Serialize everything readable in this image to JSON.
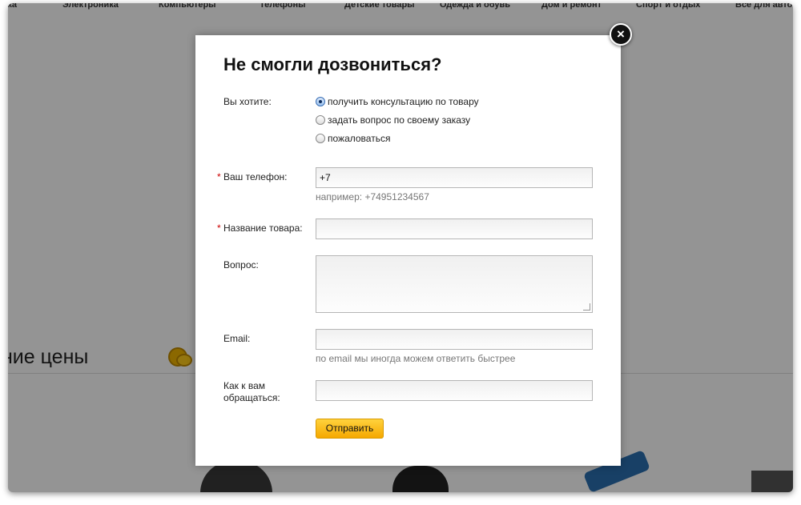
{
  "background": {
    "nav_items": [
      "ника",
      "Электроника",
      "Компьютеры",
      "Телефоны",
      "Детские товары",
      "Одежда и обувь",
      "Дом и ремонт",
      "Спорт и отдых",
      "Все для авто"
    ],
    "section_title": "ние цены"
  },
  "modal": {
    "title": "Не смогли дозвониться?",
    "close_label": "×",
    "intent": {
      "label": "Вы хотите:",
      "options": [
        "получить консультацию по товару",
        "задать вопрос по своему заказу",
        "пожаловаться"
      ],
      "selected_index": 0
    },
    "phone": {
      "label": "Ваш телефон:",
      "value": "+7",
      "hint": "например: +74951234567"
    },
    "product": {
      "label": "Название товара:",
      "value": ""
    },
    "question": {
      "label": "Вопрос:",
      "value": ""
    },
    "email": {
      "label": "Email:",
      "value": "",
      "hint": "по email мы иногда можем ответить быстрее"
    },
    "name": {
      "label": "Как к вам обращаться:",
      "value": ""
    },
    "required_mark": "*",
    "submit_label": "Отправить"
  },
  "colors": {
    "accent": "#f5a800",
    "required": "#cc0000",
    "overlay": "rgba(0,0,0,0.42)"
  }
}
